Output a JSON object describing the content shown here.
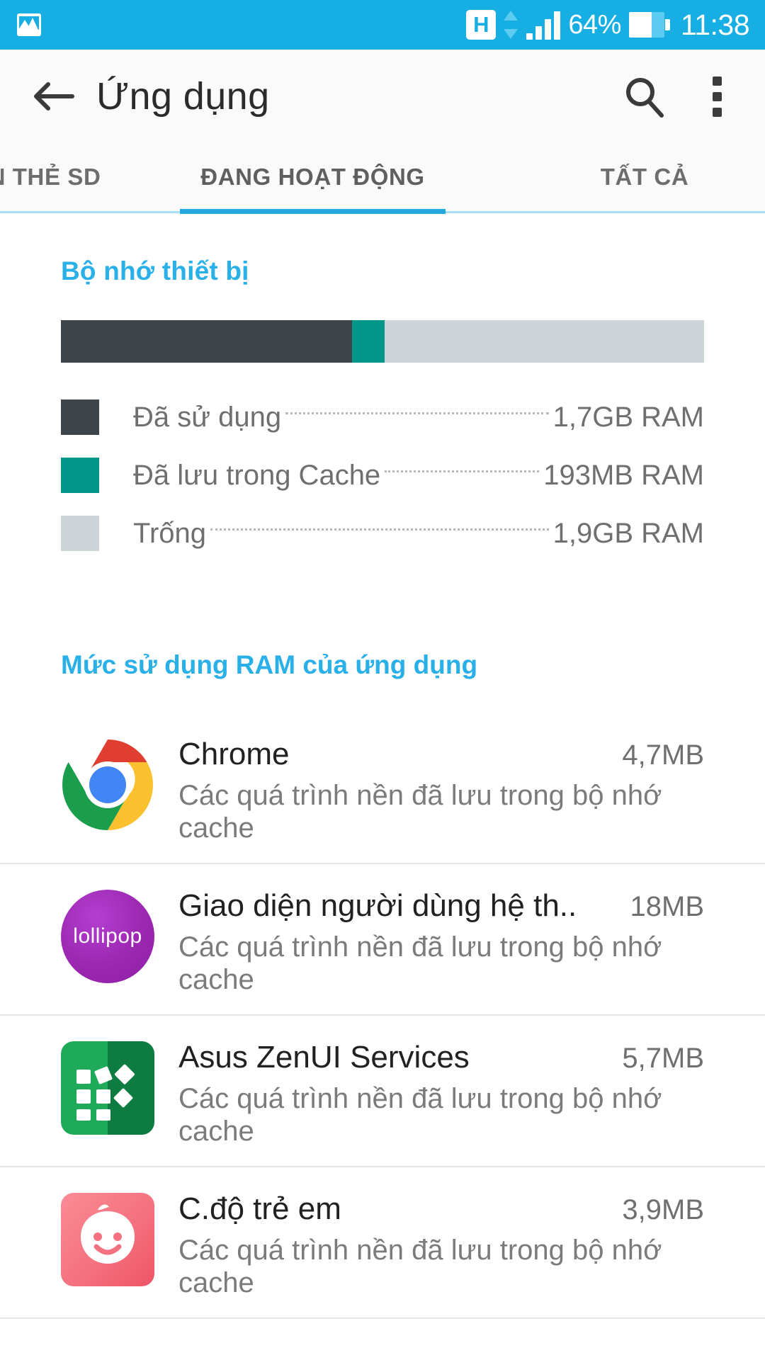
{
  "status_bar": {
    "gallery_icon": "gallery-icon",
    "network_type": "H",
    "data_arrows_icon": "data-transfer-icon",
    "signal_icon": "signal-bars-icon",
    "battery_percent": "64%",
    "battery_level": 64,
    "battery_icon": "battery-icon",
    "clock": "11:38",
    "background_color": "#16aee3"
  },
  "action_bar": {
    "back_icon": "back-arrow-icon",
    "title": "Ứng dụng",
    "search_icon": "search-icon",
    "overflow_icon": "overflow-menu-icon"
  },
  "tabs": {
    "items": [
      {
        "label": "N THẺ SD",
        "active": false
      },
      {
        "label": "ĐANG HOẠT ĐỘNG",
        "active": true
      },
      {
        "label": "TẤT CẢ",
        "active": false
      }
    ],
    "indicator_color": "#23a9e0"
  },
  "device_memory": {
    "title": "Bộ nhớ thiết bị",
    "accent_color": "#29b0e8",
    "bar": {
      "used_percent": 45.3,
      "cached_percent": 5.0,
      "free_percent": 49.7,
      "used_color": "#3d444a",
      "cached_color": "#009688",
      "free_color": "#cdd5d9"
    },
    "legend": [
      {
        "color": "#3d444a",
        "label": "Đã sử dụng",
        "value": "1,7GB RAM"
      },
      {
        "color": "#009688",
        "label": "Đã lưu trong Cache",
        "value": "193MB RAM"
      },
      {
        "color": "#cdd5d9",
        "label": "Trống",
        "value": "1,9GB RAM"
      }
    ]
  },
  "app_ram_usage": {
    "title": "Mức sử dụng RAM của ứng dụng",
    "accent_color": "#29b0e8",
    "apps": [
      {
        "icon": "chrome-icon",
        "name": "Chrome",
        "size": "4,7MB",
        "subtitle": "Các quá trình nền đã lưu trong bộ nhớ cache"
      },
      {
        "icon": "lollipop-icon",
        "icon_text": "lollipop",
        "name": "Giao diện người dùng hệ th..",
        "size": "18MB",
        "subtitle": "Các quá trình nền đã lưu trong bộ nhớ cache"
      },
      {
        "icon": "asus-zenui-icon",
        "name": "Asus ZenUI Services",
        "size": "5,7MB",
        "subtitle": "Các quá trình nền đã lưu trong bộ nhớ cache"
      },
      {
        "icon": "kids-mode-icon",
        "name": "C.độ trẻ em",
        "size": "3,9MB",
        "subtitle": "Các quá trình nền đã lưu trong bộ nhớ cache"
      }
    ]
  }
}
